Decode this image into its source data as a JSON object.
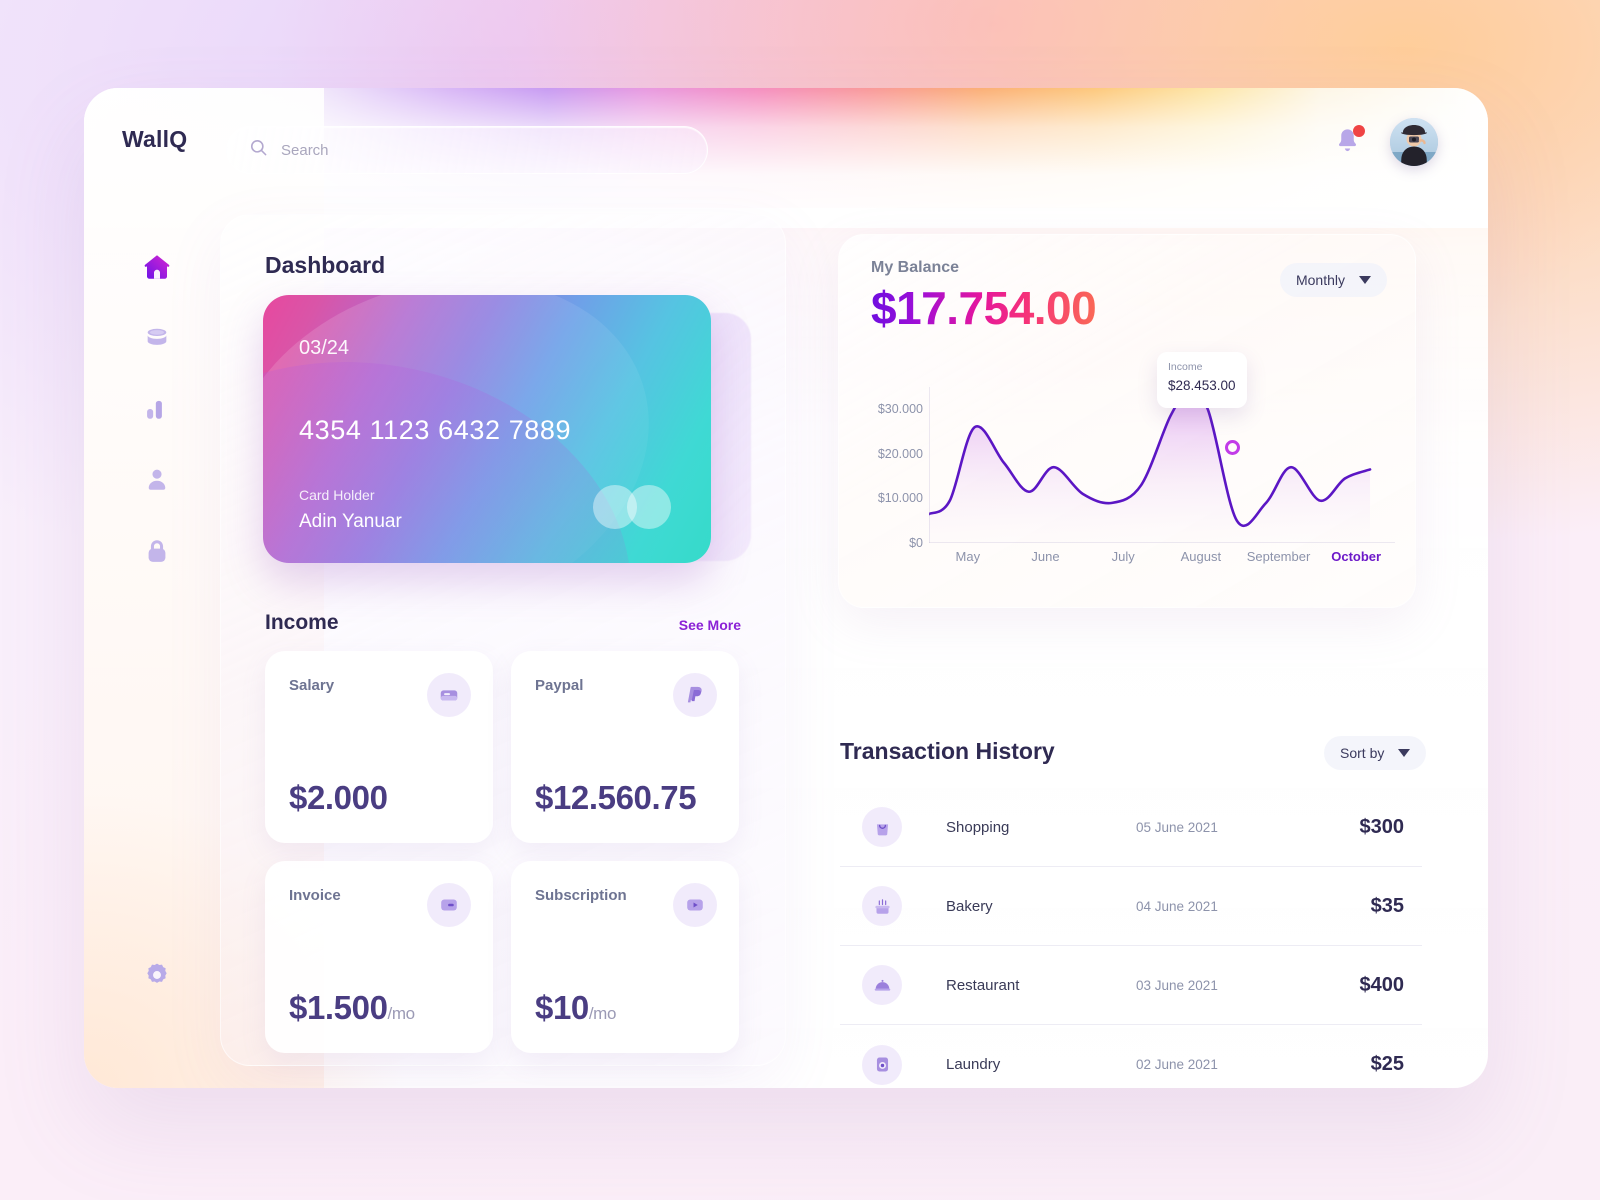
{
  "app": {
    "logo": "WallQ"
  },
  "search": {
    "placeholder": "Search",
    "value": ""
  },
  "sidebar": {
    "items": [
      {
        "name": "home",
        "icon": "home-icon",
        "active": true
      },
      {
        "name": "wallet",
        "icon": "database-icon",
        "active": false
      },
      {
        "name": "statistics",
        "icon": "bar-chart-icon",
        "active": false
      },
      {
        "name": "profile",
        "icon": "user-icon",
        "active": false
      },
      {
        "name": "security",
        "icon": "lock-icon",
        "active": false
      }
    ],
    "settings": {
      "name": "settings",
      "icon": "gear-icon"
    }
  },
  "dashboard": {
    "title": "Dashboard",
    "card": {
      "expiry": "03/24",
      "number": "4354 1123 6432 7889",
      "holder_label": "Card Holder",
      "holder_name": "Adin Yanuar"
    }
  },
  "income": {
    "title": "Income",
    "see_more": "See More",
    "cards": [
      {
        "label": "Salary",
        "amount": "$2.000",
        "per": "",
        "icon": "card-icon"
      },
      {
        "label": "Paypal",
        "amount": "$12.560.75",
        "per": "",
        "icon": "paypal-icon"
      },
      {
        "label": "Invoice",
        "amount": "$1.500",
        "per": "/mo",
        "icon": "invoice-icon"
      },
      {
        "label": "Subscription",
        "amount": "$10",
        "per": "/mo",
        "icon": "play-icon"
      }
    ]
  },
  "balance": {
    "label": "My Balance",
    "amount": "$17.754.00",
    "period": "Monthly",
    "tooltip": {
      "label": "Income",
      "value": "$28.453.00"
    }
  },
  "chart_data": {
    "type": "line",
    "title": "My Balance",
    "xlabel": "",
    "ylabel": "",
    "ylim": [
      0,
      35000
    ],
    "grid": false,
    "legend": "none",
    "yticks": [
      "$0",
      "$10.000",
      "$20.000",
      "$30.000"
    ],
    "ytick_values": [
      0,
      10000,
      20000,
      30000
    ],
    "categories": [
      "May",
      "June",
      "July",
      "August",
      "September",
      "October"
    ],
    "active_category": "October",
    "series": [
      {
        "name": "Income",
        "color": "#5b16c4",
        "x": [
          0,
          0.25,
          0.55,
          0.9,
          1.2,
          1.5,
          1.85,
          2.2,
          2.55,
          2.9,
          3.1,
          3.35,
          3.7,
          4.05,
          4.35,
          4.7,
          5.0,
          5.3
        ],
        "values": [
          6500,
          9500,
          26000,
          18000,
          11500,
          17000,
          11000,
          9000,
          13000,
          28453,
          33000,
          30000,
          5000,
          9000,
          17000,
          9500,
          14500,
          16500
        ]
      }
    ],
    "annotations": [
      {
        "label": "Income",
        "value": "$28.453.00",
        "at_x": 2.9,
        "at_y": 28453
      }
    ]
  },
  "transactions": {
    "title": "Transaction History",
    "sort_label": "Sort by",
    "rows": [
      {
        "icon": "shopping-bag-icon",
        "name": "Shopping",
        "date": "05 June 2021",
        "amount": "$300"
      },
      {
        "icon": "cake-icon",
        "name": "Bakery",
        "date": "04 June 2021",
        "amount": "$35"
      },
      {
        "icon": "food-dome-icon",
        "name": "Restaurant",
        "date": "03 June 2021",
        "amount": "$400"
      },
      {
        "icon": "washer-icon",
        "name": "Laundry",
        "date": "02 June 2021",
        "amount": "$25"
      }
    ]
  },
  "colors": {
    "accent": "#8b21d6",
    "chart_line": "#5b16c4",
    "notification": "#ef4444",
    "text_dark": "#2f2a52"
  }
}
